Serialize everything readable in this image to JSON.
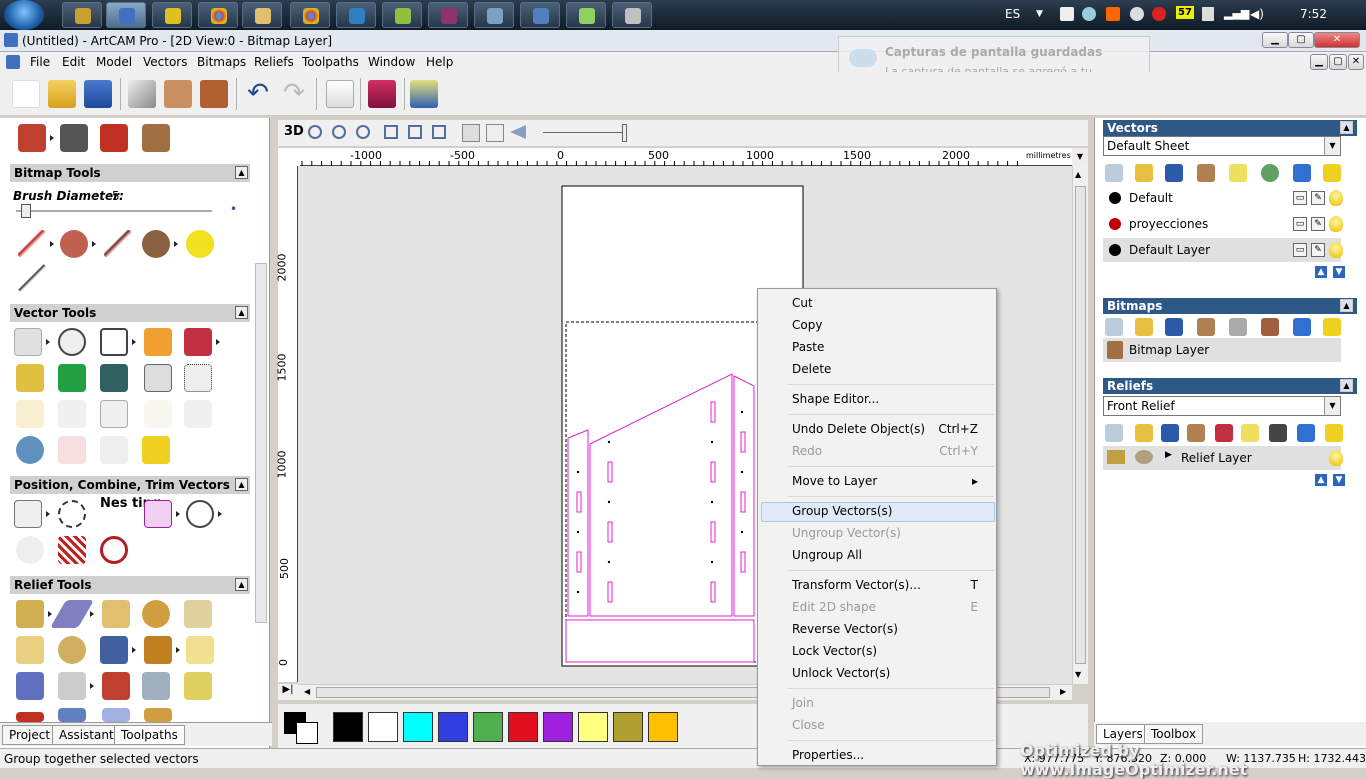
{
  "taskbar": {
    "lang": "ES",
    "clock": "7:52",
    "badge": "57"
  },
  "window": {
    "title": "(Untitled) - ArtCAM Pro - [2D View:0 - Bitmap Layer]"
  },
  "menubar": [
    "File",
    "Edit",
    "Model",
    "Vectors",
    "Bitmaps",
    "Reliefs",
    "Toolpaths",
    "Window",
    "Help"
  ],
  "toast": {
    "title": "Capturas de pantalla guardadas",
    "body": "La captura de pantalla se agregó a tu OneDrive."
  },
  "left": {
    "bitmap_tools": "Bitmap Tools",
    "brush_label": "Brush Diameter:",
    "brush_value": "5",
    "vector_tools": "Vector Tools",
    "position_tools": "Position, Combine, Trim Vectors",
    "relief_tools": "Relief Tools",
    "nesting_label": "Nes ting",
    "tabs": [
      "Project",
      "Assistant",
      "Toolpaths"
    ]
  },
  "view": {
    "btn_3d": "3D",
    "ruler_top": [
      "-1000",
      "-500",
      "0",
      "500",
      "1000",
      "1500",
      "2000"
    ],
    "units": "millimetres",
    "ruler_left": [
      "2000",
      "1500",
      "1000",
      "500",
      "0"
    ]
  },
  "palette": [
    "#000000",
    "#ffffff",
    "#00ffff",
    "#3040e0",
    "#50b050",
    "#e01020",
    "#a020e0",
    "#ffff80",
    "#b0a030",
    "#ffc000"
  ],
  "right": {
    "vectors_title": "Vectors",
    "vectors_sheet": "Default Sheet",
    "layers": [
      {
        "name": "Default",
        "color": "#000000"
      },
      {
        "name": "proyecciones",
        "color": "#c00000"
      },
      {
        "name": "Default Layer",
        "color": "#000000"
      }
    ],
    "bitmaps_title": "Bitmaps",
    "bitmap_layer": "Bitmap Layer",
    "reliefs_title": "Reliefs",
    "relief_combo": "Front Relief",
    "relief_layer": "Relief Layer",
    "tabs": [
      "Layers",
      "Toolbox"
    ]
  },
  "context_menu": [
    {
      "label": "Cut",
      "shortcut": "",
      "disabled": false
    },
    {
      "label": "Copy",
      "shortcut": "",
      "disabled": false
    },
    {
      "label": "Paste",
      "shortcut": "",
      "disabled": false
    },
    {
      "label": "Delete",
      "shortcut": "",
      "disabled": false
    },
    {
      "label": "Shape Editor...",
      "shortcut": "",
      "disabled": false
    },
    {
      "label": "Undo Delete Object(s)",
      "shortcut": "Ctrl+Z",
      "disabled": false
    },
    {
      "label": "Redo",
      "shortcut": "Ctrl+Y",
      "disabled": true
    },
    {
      "label": "Move to Layer",
      "shortcut": "▸",
      "disabled": false
    },
    {
      "label": "Group Vectors(s)",
      "shortcut": "",
      "disabled": false,
      "highlight": true
    },
    {
      "label": "Ungroup Vector(s)",
      "shortcut": "",
      "disabled": true
    },
    {
      "label": "Ungroup All",
      "shortcut": "",
      "disabled": false
    },
    {
      "label": "Transform Vector(s)...",
      "shortcut": "T",
      "disabled": false
    },
    {
      "label": "Edit 2D shape",
      "shortcut": "E",
      "disabled": true
    },
    {
      "label": "Reverse Vector(s)",
      "shortcut": "",
      "disabled": false
    },
    {
      "label": "Lock Vector(s)",
      "shortcut": "",
      "disabled": false
    },
    {
      "label": "Unlock Vector(s)",
      "shortcut": "",
      "disabled": false
    },
    {
      "label": "Join",
      "shortcut": "",
      "disabled": true
    },
    {
      "label": "Close",
      "shortcut": "",
      "disabled": true
    },
    {
      "label": "Properties...",
      "shortcut": "",
      "disabled": false
    }
  ],
  "status": {
    "text": "Group together selected vectors",
    "x": "X: 977.775",
    "y": "Y: 876.320",
    "z": "Z: 0.000",
    "w": "W: 1137.735",
    "h": "H: 1732.443"
  },
  "watermark": "Optimized by www.ImageOptimizer.net"
}
